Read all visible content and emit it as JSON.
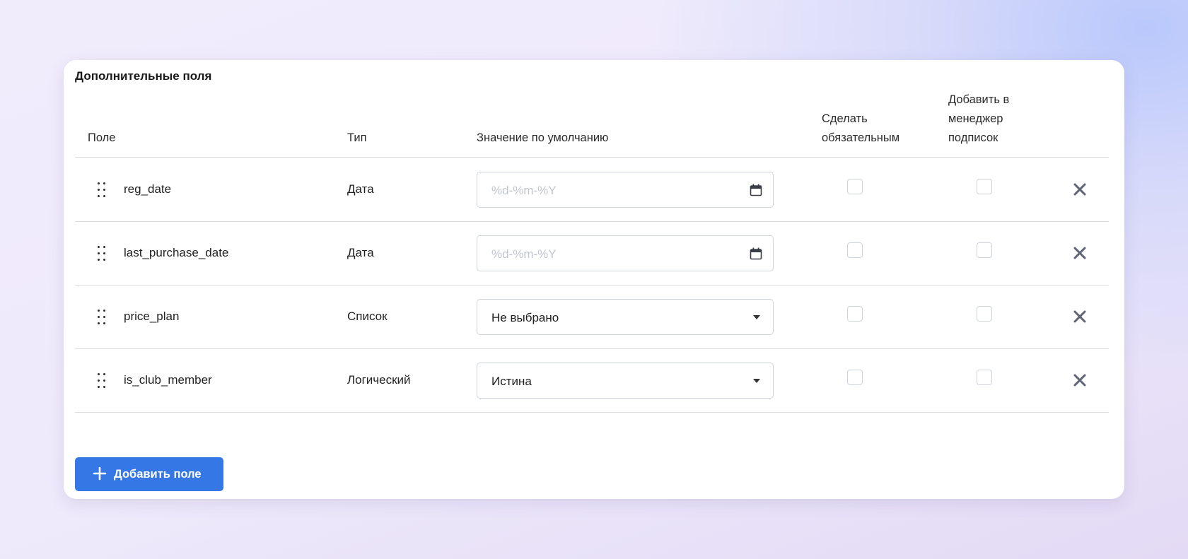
{
  "section": {
    "title": "Дополнительные поля"
  },
  "columns": {
    "field": "Поле",
    "type": "Тип",
    "default": "Значение по умолчанию",
    "required_line1": "Сделать",
    "required_line2": "обязательным",
    "subscriptions_line1": "Добавить в",
    "subscriptions_line2": "менеджер",
    "subscriptions_line3": "подписок"
  },
  "rows": [
    {
      "field": "reg_date",
      "type": "Дата",
      "control": "date",
      "placeholder": "%d-%m-%Y",
      "value": "",
      "required": false,
      "in_subscription_manager": false
    },
    {
      "field": "last_purchase_date",
      "type": "Дата",
      "control": "date",
      "placeholder": "%d-%m-%Y",
      "value": "",
      "required": false,
      "in_subscription_manager": false
    },
    {
      "field": "price_plan",
      "type": "Список",
      "control": "select",
      "placeholder": "",
      "value": "Не выбрано",
      "required": false,
      "in_subscription_manager": false
    },
    {
      "field": "is_club_member",
      "type": "Логический",
      "control": "select",
      "placeholder": "",
      "value": "Истина",
      "required": false,
      "in_subscription_manager": false
    }
  ],
  "actions": {
    "add_field": "Добавить поле"
  },
  "colors": {
    "accent": "#3578e5",
    "delete_icon": "#5f6577",
    "border": "#cfd3da"
  },
  "icons": {
    "drag": "drag-handle-icon",
    "calendar": "calendar-icon",
    "dropdown": "chevron-down-icon",
    "delete": "close-icon",
    "add": "plus-icon"
  }
}
